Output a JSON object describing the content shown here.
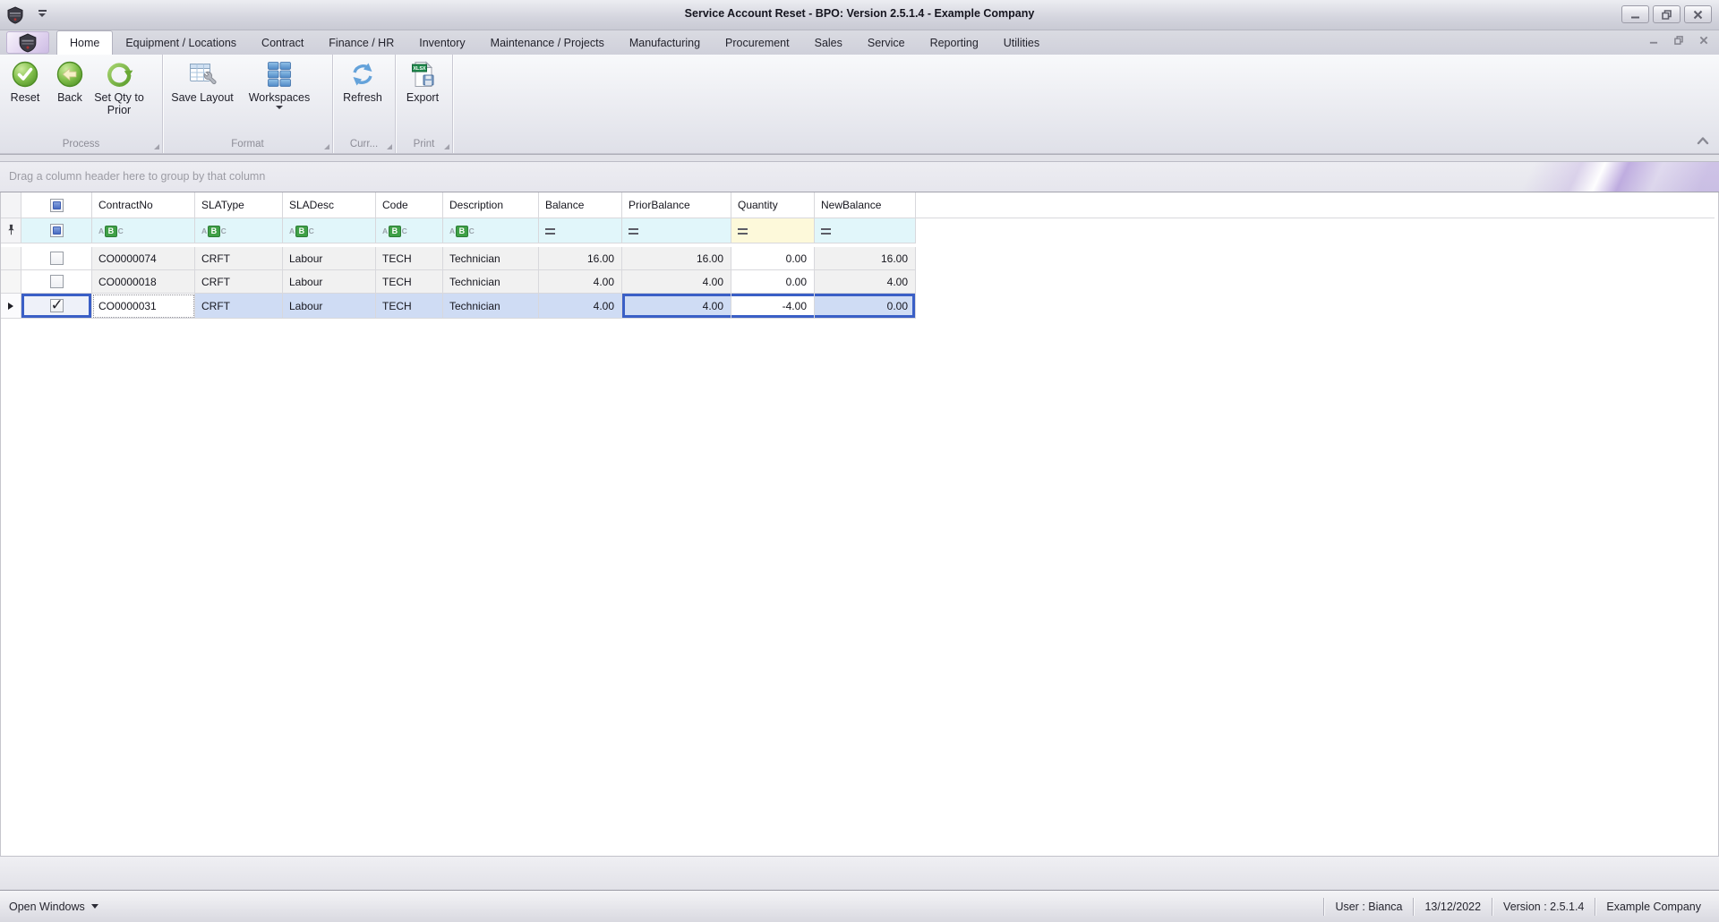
{
  "window": {
    "title": "Service Account Reset - BPO: Version 2.5.1.4 - Example Company"
  },
  "tabs": {
    "active": "Home",
    "items": [
      "Home",
      "Equipment / Locations",
      "Contract",
      "Finance / HR",
      "Inventory",
      "Maintenance / Projects",
      "Manufacturing",
      "Procurement",
      "Sales",
      "Service",
      "Reporting",
      "Utilities"
    ]
  },
  "ribbon": {
    "groups": [
      {
        "label": "Process",
        "buttons": [
          {
            "label": "Reset",
            "icon": "reset-check-icon"
          },
          {
            "label": "Back",
            "icon": "back-arrow-icon"
          },
          {
            "label": "Set Qty to Prior",
            "icon": "set-qty-circular-arrow-icon"
          }
        ]
      },
      {
        "label": "Format",
        "buttons": [
          {
            "label": "Save Layout",
            "icon": "save-layout-grid-wrench-icon"
          },
          {
            "label": "Workspaces",
            "icon": "workspaces-tiles-icon",
            "has_dropdown": true
          }
        ]
      },
      {
        "label": "Curr...",
        "buttons": [
          {
            "label": "Refresh",
            "icon": "refresh-arrows-icon"
          }
        ]
      },
      {
        "label": "Print",
        "buttons": [
          {
            "label": "Export",
            "icon": "export-xlsx-icon"
          }
        ]
      }
    ]
  },
  "grid": {
    "group_by_hint": "Drag a column header here to group by that column",
    "columns": [
      "ContractNo",
      "SLAType",
      "SLADesc",
      "Code",
      "Description",
      "Balance",
      "PriorBalance",
      "Quantity",
      "NewBalance"
    ],
    "rows": [
      {
        "checked": false,
        "contract_no": "CO0000074",
        "sla_type": "CRFT",
        "sla_desc": "Labour",
        "code": "TECH",
        "description": "Technician",
        "balance": "16.00",
        "prior_balance": "16.00",
        "quantity": "0.00",
        "new_balance": "16.00"
      },
      {
        "checked": false,
        "contract_no": "CO0000018",
        "sla_type": "CRFT",
        "sla_desc": "Labour",
        "code": "TECH",
        "description": "Technician",
        "balance": "4.00",
        "prior_balance": "4.00",
        "quantity": "0.00",
        "new_balance": "4.00"
      },
      {
        "checked": true,
        "contract_no": "CO0000031",
        "sla_type": "CRFT",
        "sla_desc": "Labour",
        "code": "TECH",
        "description": "Technician",
        "balance": "4.00",
        "prior_balance": "4.00",
        "quantity": "-4.00",
        "new_balance": "0.00"
      }
    ],
    "selected_row_index": 2
  },
  "status_bar": {
    "open_windows_label": "Open Windows",
    "user": "User : Bianca",
    "date": "13/12/2022",
    "version": "Version : 2.5.1.4",
    "company": "Example Company"
  },
  "colors": {
    "selection_row": "#cfdcf4",
    "focus_border": "#3a5fc6",
    "filter_row": "#e1f6fa",
    "filter_row_active_cell": "#fdf9da",
    "accent_green": "#6fae3a",
    "accent_blue": "#5b9bd5",
    "xlsx_green": "#1f8a4c"
  }
}
